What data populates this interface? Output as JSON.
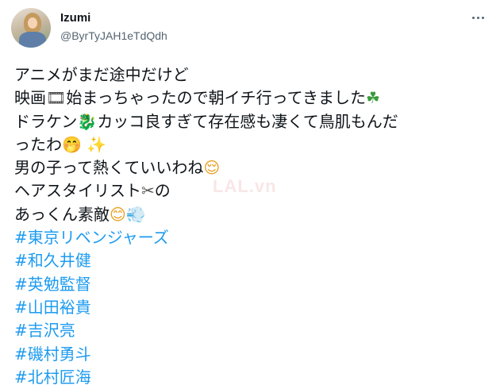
{
  "user": {
    "name": "Izumi",
    "handle": "@ByrTyJAH1eTdQdh"
  },
  "icons": {
    "more": "more-horizontal-icon"
  },
  "tweet": {
    "line1": "アニメがまだ途中だけど",
    "line2_a": "映画",
    "line2_emoji": "🎞",
    "line2_b": "始まっちゃったので朝イチ行ってきました",
    "line2_emoji2": "☘",
    "line3_a": "ドラケン",
    "line3_emoji": "🐉",
    "line3_b": "カッコ良すぎて存在感も凄くて鳥肌もんだ",
    "line4_a": "ったわ",
    "line4_emoji": "🤭",
    "line4_emoji2": "✨",
    "line5_a": "男の子って熱くていいわね",
    "line5_emoji": "😌",
    "line6_a": "ヘアスタイリスト",
    "line6_emoji": "✂",
    "line6_b": "の",
    "line7_a": "あっくん素敵",
    "line7_emoji": "😊",
    "line7_emoji2": "💨",
    "hashtags": [
      "#東京リベンジャーズ",
      "#和久井健",
      "#英勉監督",
      "#山田裕貴",
      "#吉沢亮",
      "#磯村勇斗",
      "#北村匠海"
    ]
  },
  "watermark": "LAL.vn",
  "colors": {
    "text": "#0f1419",
    "secondary": "#536471",
    "link": "#1d9bf0"
  }
}
